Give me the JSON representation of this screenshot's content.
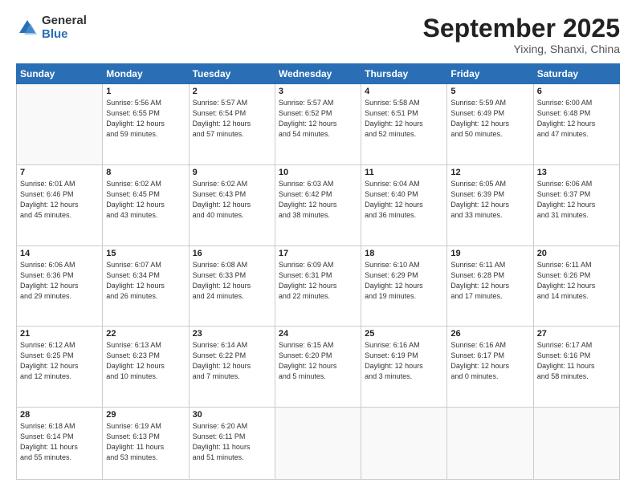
{
  "logo": {
    "general": "General",
    "blue": "Blue"
  },
  "header": {
    "month": "September 2025",
    "location": "Yixing, Shanxi, China"
  },
  "days_of_week": [
    "Sunday",
    "Monday",
    "Tuesday",
    "Wednesday",
    "Thursday",
    "Friday",
    "Saturday"
  ],
  "weeks": [
    [
      {
        "num": "",
        "info": ""
      },
      {
        "num": "1",
        "info": "Sunrise: 5:56 AM\nSunset: 6:55 PM\nDaylight: 12 hours\nand 59 minutes."
      },
      {
        "num": "2",
        "info": "Sunrise: 5:57 AM\nSunset: 6:54 PM\nDaylight: 12 hours\nand 57 minutes."
      },
      {
        "num": "3",
        "info": "Sunrise: 5:57 AM\nSunset: 6:52 PM\nDaylight: 12 hours\nand 54 minutes."
      },
      {
        "num": "4",
        "info": "Sunrise: 5:58 AM\nSunset: 6:51 PM\nDaylight: 12 hours\nand 52 minutes."
      },
      {
        "num": "5",
        "info": "Sunrise: 5:59 AM\nSunset: 6:49 PM\nDaylight: 12 hours\nand 50 minutes."
      },
      {
        "num": "6",
        "info": "Sunrise: 6:00 AM\nSunset: 6:48 PM\nDaylight: 12 hours\nand 47 minutes."
      }
    ],
    [
      {
        "num": "7",
        "info": "Sunrise: 6:01 AM\nSunset: 6:46 PM\nDaylight: 12 hours\nand 45 minutes."
      },
      {
        "num": "8",
        "info": "Sunrise: 6:02 AM\nSunset: 6:45 PM\nDaylight: 12 hours\nand 43 minutes."
      },
      {
        "num": "9",
        "info": "Sunrise: 6:02 AM\nSunset: 6:43 PM\nDaylight: 12 hours\nand 40 minutes."
      },
      {
        "num": "10",
        "info": "Sunrise: 6:03 AM\nSunset: 6:42 PM\nDaylight: 12 hours\nand 38 minutes."
      },
      {
        "num": "11",
        "info": "Sunrise: 6:04 AM\nSunset: 6:40 PM\nDaylight: 12 hours\nand 36 minutes."
      },
      {
        "num": "12",
        "info": "Sunrise: 6:05 AM\nSunset: 6:39 PM\nDaylight: 12 hours\nand 33 minutes."
      },
      {
        "num": "13",
        "info": "Sunrise: 6:06 AM\nSunset: 6:37 PM\nDaylight: 12 hours\nand 31 minutes."
      }
    ],
    [
      {
        "num": "14",
        "info": "Sunrise: 6:06 AM\nSunset: 6:36 PM\nDaylight: 12 hours\nand 29 minutes."
      },
      {
        "num": "15",
        "info": "Sunrise: 6:07 AM\nSunset: 6:34 PM\nDaylight: 12 hours\nand 26 minutes."
      },
      {
        "num": "16",
        "info": "Sunrise: 6:08 AM\nSunset: 6:33 PM\nDaylight: 12 hours\nand 24 minutes."
      },
      {
        "num": "17",
        "info": "Sunrise: 6:09 AM\nSunset: 6:31 PM\nDaylight: 12 hours\nand 22 minutes."
      },
      {
        "num": "18",
        "info": "Sunrise: 6:10 AM\nSunset: 6:29 PM\nDaylight: 12 hours\nand 19 minutes."
      },
      {
        "num": "19",
        "info": "Sunrise: 6:11 AM\nSunset: 6:28 PM\nDaylight: 12 hours\nand 17 minutes."
      },
      {
        "num": "20",
        "info": "Sunrise: 6:11 AM\nSunset: 6:26 PM\nDaylight: 12 hours\nand 14 minutes."
      }
    ],
    [
      {
        "num": "21",
        "info": "Sunrise: 6:12 AM\nSunset: 6:25 PM\nDaylight: 12 hours\nand 12 minutes."
      },
      {
        "num": "22",
        "info": "Sunrise: 6:13 AM\nSunset: 6:23 PM\nDaylight: 12 hours\nand 10 minutes."
      },
      {
        "num": "23",
        "info": "Sunrise: 6:14 AM\nSunset: 6:22 PM\nDaylight: 12 hours\nand 7 minutes."
      },
      {
        "num": "24",
        "info": "Sunrise: 6:15 AM\nSunset: 6:20 PM\nDaylight: 12 hours\nand 5 minutes."
      },
      {
        "num": "25",
        "info": "Sunrise: 6:16 AM\nSunset: 6:19 PM\nDaylight: 12 hours\nand 3 minutes."
      },
      {
        "num": "26",
        "info": "Sunrise: 6:16 AM\nSunset: 6:17 PM\nDaylight: 12 hours\nand 0 minutes."
      },
      {
        "num": "27",
        "info": "Sunrise: 6:17 AM\nSunset: 6:16 PM\nDaylight: 11 hours\nand 58 minutes."
      }
    ],
    [
      {
        "num": "28",
        "info": "Sunrise: 6:18 AM\nSunset: 6:14 PM\nDaylight: 11 hours\nand 55 minutes."
      },
      {
        "num": "29",
        "info": "Sunrise: 6:19 AM\nSunset: 6:13 PM\nDaylight: 11 hours\nand 53 minutes."
      },
      {
        "num": "30",
        "info": "Sunrise: 6:20 AM\nSunset: 6:11 PM\nDaylight: 11 hours\nand 51 minutes."
      },
      {
        "num": "",
        "info": ""
      },
      {
        "num": "",
        "info": ""
      },
      {
        "num": "",
        "info": ""
      },
      {
        "num": "",
        "info": ""
      }
    ]
  ]
}
